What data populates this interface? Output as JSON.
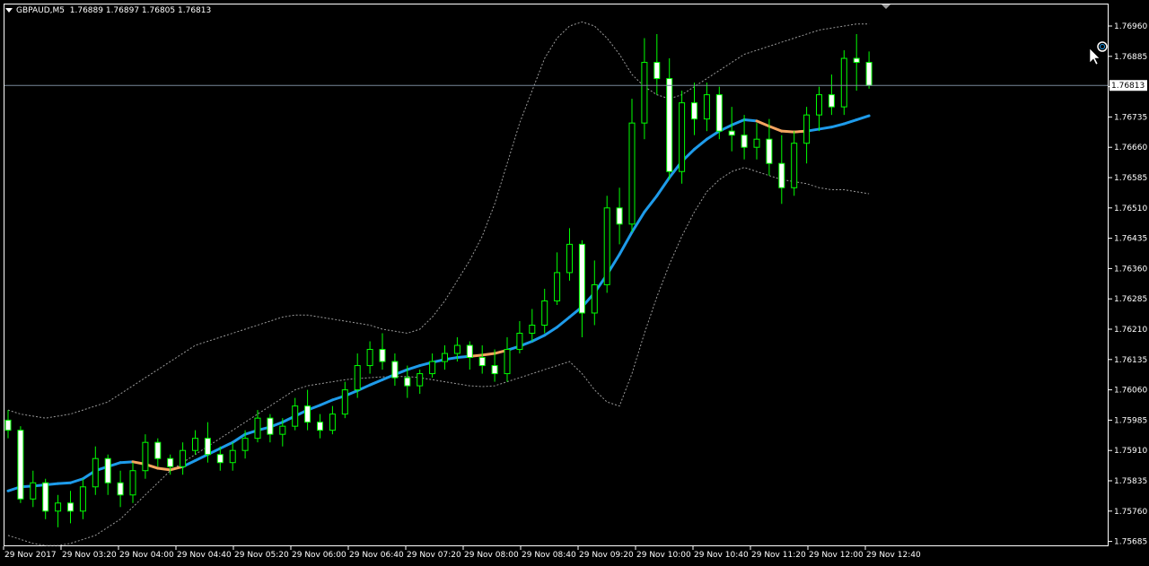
{
  "window": {
    "symbol": "GBPAUD,M5",
    "ohlc": "1.76889 1.76897 1.76805 1.76813"
  },
  "colors": {
    "background": "#000000",
    "frame": "#ffffff",
    "bull_candle": "#000000",
    "bear_candle": "#ffffff",
    "wick": "#00ff00",
    "ma_up": "#1e9bea",
    "ma_down": "#f4a460",
    "bands": "#9a9a9a",
    "bid_line": "#778899"
  },
  "price_axis": {
    "ticks": [
      "1.76960",
      "1.76885",
      "1.76810",
      "1.76735",
      "1.76660",
      "1.76585",
      "1.76510",
      "1.76435",
      "1.76360",
      "1.76285",
      "1.76210",
      "1.76135",
      "1.76060",
      "1.75985",
      "1.75910",
      "1.75835",
      "1.75760",
      "1.75685"
    ],
    "current_price_label": "1.76813"
  },
  "time_axis": {
    "labels": [
      "29 Nov 2017",
      "29 Nov 03:20",
      "29 Nov 04:00",
      "29 Nov 04:40",
      "29 Nov 05:20",
      "29 Nov 06:00",
      "29 Nov 06:40",
      "29 Nov 07:20",
      "29 Nov 08:00",
      "29 Nov 08:40",
      "29 Nov 09:20",
      "29 Nov 10:00",
      "29 Nov 10:40",
      "29 Nov 11:20",
      "29 Nov 12:00",
      "29 Nov 12:40"
    ]
  },
  "chart_data": {
    "type": "candlestick",
    "instrument": "GBPAUD",
    "timeframe": "M5",
    "ylim": [
      1.75685,
      1.77
    ],
    "current_price": 1.76813,
    "candles": [
      [
        1.75985,
        1.7601,
        1.7594,
        1.7596
      ],
      [
        1.7596,
        1.7597,
        1.7578,
        1.7579
      ],
      [
        1.7579,
        1.7586,
        1.7577,
        1.7583
      ],
      [
        1.7583,
        1.7584,
        1.7574,
        1.7576
      ],
      [
        1.7576,
        1.758,
        1.7572,
        1.7578
      ],
      [
        1.7578,
        1.7581,
        1.7573,
        1.7576
      ],
      [
        1.7576,
        1.7584,
        1.7574,
        1.7582
      ],
      [
        1.7582,
        1.7592,
        1.758,
        1.7589
      ],
      [
        1.7589,
        1.759,
        1.758,
        1.7583
      ],
      [
        1.7583,
        1.7586,
        1.7577,
        1.758
      ],
      [
        1.758,
        1.7588,
        1.7578,
        1.7586
      ],
      [
        1.7586,
        1.7595,
        1.7584,
        1.7593
      ],
      [
        1.7593,
        1.7594,
        1.7587,
        1.7589
      ],
      [
        1.7589,
        1.759,
        1.7585,
        1.7587
      ],
      [
        1.7587,
        1.7593,
        1.7585,
        1.7591
      ],
      [
        1.7591,
        1.7596,
        1.759,
        1.7594
      ],
      [
        1.7594,
        1.7598,
        1.7588,
        1.759
      ],
      [
        1.759,
        1.7592,
        1.7586,
        1.7588
      ],
      [
        1.7588,
        1.7593,
        1.7586,
        1.7591
      ],
      [
        1.7591,
        1.7596,
        1.7589,
        1.7594
      ],
      [
        1.7594,
        1.7601,
        1.7593,
        1.7599
      ],
      [
        1.7599,
        1.76,
        1.7593,
        1.7595
      ],
      [
        1.7595,
        1.7599,
        1.7592,
        1.7597
      ],
      [
        1.7597,
        1.7604,
        1.7596,
        1.7602
      ],
      [
        1.7602,
        1.7606,
        1.7596,
        1.7598
      ],
      [
        1.7598,
        1.76,
        1.7594,
        1.7596
      ],
      [
        1.7596,
        1.7602,
        1.7595,
        1.76
      ],
      [
        1.76,
        1.7608,
        1.7599,
        1.7606
      ],
      [
        1.7606,
        1.7615,
        1.7604,
        1.7612
      ],
      [
        1.7612,
        1.7618,
        1.761,
        1.7616
      ],
      [
        1.7616,
        1.762,
        1.7611,
        1.7613
      ],
      [
        1.7613,
        1.7615,
        1.7607,
        1.7609
      ],
      [
        1.7609,
        1.7612,
        1.7604,
        1.7607
      ],
      [
        1.7607,
        1.7611,
        1.7605,
        1.761
      ],
      [
        1.761,
        1.7615,
        1.7609,
        1.7613
      ],
      [
        1.7613,
        1.7617,
        1.7611,
        1.7615
      ],
      [
        1.7615,
        1.7619,
        1.7613,
        1.7617
      ],
      [
        1.7617,
        1.7618,
        1.7611,
        1.7614
      ],
      [
        1.7614,
        1.7617,
        1.761,
        1.7612
      ],
      [
        1.7612,
        1.7616,
        1.7608,
        1.761
      ],
      [
        1.761,
        1.7619,
        1.7608,
        1.7616
      ],
      [
        1.7616,
        1.7623,
        1.7615,
        1.762
      ],
      [
        1.762,
        1.7626,
        1.7618,
        1.7622
      ],
      [
        1.7622,
        1.7631,
        1.762,
        1.7628
      ],
      [
        1.7628,
        1.764,
        1.7627,
        1.7635
      ],
      [
        1.7635,
        1.7646,
        1.7633,
        1.7642
      ],
      [
        1.7642,
        1.7643,
        1.7619,
        1.7625
      ],
      [
        1.7625,
        1.7638,
        1.7622,
        1.7632
      ],
      [
        1.7632,
        1.7654,
        1.763,
        1.7651
      ],
      [
        1.7651,
        1.7656,
        1.7642,
        1.7647
      ],
      [
        1.7647,
        1.7678,
        1.7645,
        1.7672
      ],
      [
        1.7672,
        1.7693,
        1.7668,
        1.7687
      ],
      [
        1.7687,
        1.7694,
        1.7679,
        1.7683
      ],
      [
        1.7683,
        1.7688,
        1.7658,
        1.766
      ],
      [
        1.766,
        1.768,
        1.7657,
        1.7677
      ],
      [
        1.7677,
        1.7682,
        1.7669,
        1.7673
      ],
      [
        1.7673,
        1.7682,
        1.767,
        1.7679
      ],
      [
        1.7679,
        1.7681,
        1.7668,
        1.767
      ],
      [
        1.767,
        1.7676,
        1.7665,
        1.7669
      ],
      [
        1.7669,
        1.7674,
        1.7663,
        1.7666
      ],
      [
        1.7666,
        1.7672,
        1.7663,
        1.7668
      ],
      [
        1.7668,
        1.7673,
        1.7659,
        1.7662
      ],
      [
        1.7662,
        1.7669,
        1.7652,
        1.7656
      ],
      [
        1.7656,
        1.767,
        1.7654,
        1.7667
      ],
      [
        1.7667,
        1.7676,
        1.7662,
        1.7674
      ],
      [
        1.7674,
        1.7681,
        1.767,
        1.7679
      ],
      [
        1.7679,
        1.7684,
        1.7674,
        1.7676
      ],
      [
        1.7676,
        1.769,
        1.7674,
        1.7688
      ],
      [
        1.7688,
        1.7694,
        1.768,
        1.7687
      ],
      [
        1.7687,
        1.76897,
        1.76805,
        1.76813
      ]
    ],
    "moving_average": [
      1.7581,
      1.7582,
      1.75822,
      1.75825,
      1.75828,
      1.7583,
      1.7584,
      1.7586,
      1.7587,
      1.7588,
      1.75882,
      1.75876,
      1.75866,
      1.75862,
      1.7587,
      1.75885,
      1.759,
      1.75915,
      1.7593,
      1.7595,
      1.7596,
      1.75968,
      1.7598,
      1.75995,
      1.7601,
      1.76022,
      1.76035,
      1.76045,
      1.76058,
      1.76072,
      1.76085,
      1.76098,
      1.7611,
      1.7612,
      1.76128,
      1.76135,
      1.7614,
      1.76143,
      1.76146,
      1.7615,
      1.76158,
      1.76168,
      1.7618,
      1.76195,
      1.76215,
      1.7624,
      1.76265,
      1.763,
      1.76345,
      1.76395,
      1.7645,
      1.765,
      1.7654,
      1.76585,
      1.76625,
      1.76655,
      1.7668,
      1.767,
      1.76715,
      1.76728,
      1.76725,
      1.76712,
      1.767,
      1.76698,
      1.767,
      1.76705,
      1.7671,
      1.76718,
      1.76728,
      1.76738
    ],
    "ma_down_segments": [
      [
        10,
        14
      ],
      [
        37,
        40
      ],
      [
        60,
        64
      ]
    ],
    "upper_band": [
      1.7601,
      1.76,
      1.75995,
      1.7599,
      1.75995,
      1.76,
      1.7601,
      1.7602,
      1.7603,
      1.7605,
      1.7607,
      1.7609,
      1.7611,
      1.7613,
      1.7615,
      1.7617,
      1.7618,
      1.7619,
      1.762,
      1.7621,
      1.7622,
      1.7623,
      1.7624,
      1.76245,
      1.76245,
      1.7624,
      1.76235,
      1.7623,
      1.76225,
      1.7622,
      1.7621,
      1.76205,
      1.762,
      1.7621,
      1.7624,
      1.7628,
      1.7633,
      1.7638,
      1.7644,
      1.7652,
      1.7662,
      1.7672,
      1.768,
      1.7688,
      1.7693,
      1.7696,
      1.7697,
      1.7696,
      1.7693,
      1.7689,
      1.7684,
      1.7681,
      1.7679,
      1.7678,
      1.7679,
      1.7681,
      1.7683,
      1.7685,
      1.7687,
      1.7689,
      1.769,
      1.7691,
      1.7692,
      1.7693,
      1.7694,
      1.7695,
      1.76955,
      1.7696,
      1.76965,
      1.76965
    ],
    "lower_band": [
      1.757,
      1.7569,
      1.7568,
      1.75675,
      1.75675,
      1.7568,
      1.7569,
      1.757,
      1.7572,
      1.7574,
      1.7577,
      1.758,
      1.7583,
      1.7586,
      1.7588,
      1.759,
      1.7592,
      1.7594,
      1.7596,
      1.7598,
      1.76,
      1.7602,
      1.7604,
      1.7606,
      1.7607,
      1.76075,
      1.7608,
      1.76085,
      1.76088,
      1.7609,
      1.76092,
      1.76093,
      1.76093,
      1.7609,
      1.76085,
      1.7608,
      1.76075,
      1.7607,
      1.76068,
      1.7607,
      1.7608,
      1.7609,
      1.761,
      1.7611,
      1.7612,
      1.7613,
      1.761,
      1.7606,
      1.7603,
      1.7602,
      1.761,
      1.762,
      1.7629,
      1.7637,
      1.7644,
      1.765,
      1.7655,
      1.7658,
      1.766,
      1.7661,
      1.766,
      1.7659,
      1.7658,
      1.76575,
      1.7657,
      1.7656,
      1.76555,
      1.76555,
      1.7655,
      1.76545
    ]
  }
}
